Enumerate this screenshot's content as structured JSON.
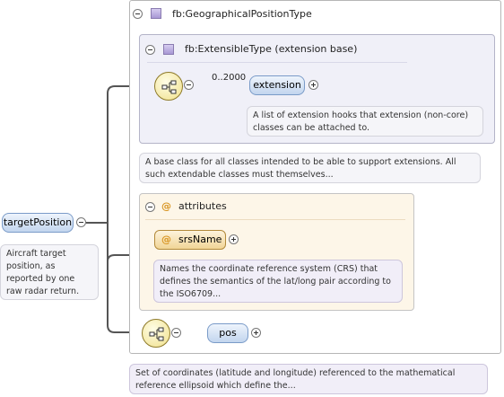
{
  "root_element": {
    "name": "targetPosition",
    "doc": "Aircraft target position, as reported by one raw radar return."
  },
  "type": {
    "name": "fb:GeographicalPositionType",
    "doc": "Set of coordinates (latitude and longitude) referenced to the mathematical reference ellipsoid which define the..."
  },
  "base_type": {
    "name": "fb:ExtensibleType (extension base)",
    "doc": "A base class for all classes intended to be able to support extensions. All such extendable classes must themselves..."
  },
  "extension_element": {
    "name": "extension",
    "occurs": "0..2000",
    "doc": "A list of extension hooks that extension (non-core) classes can be attached to."
  },
  "attributes": {
    "at_symbol": "@",
    "label": "attributes",
    "srs": {
      "name": "srsName",
      "doc": "Names the coordinate reference system (CRS) that defines the semantics of the lat/long pair according to the ISO6709..."
    }
  },
  "pos_element": {
    "name": "pos"
  },
  "icons": {
    "collapse": "collapse-minus-icon",
    "expand": "expand-plus-icon",
    "complex_type": "complex-type-icon",
    "sequence": "sequence-compositor-icon"
  },
  "colors": {
    "element_fill": "#c2d5ee",
    "attribute_fill": "#f1d596",
    "compositor_fill": "#f0e08a",
    "connector": "#555555"
  }
}
